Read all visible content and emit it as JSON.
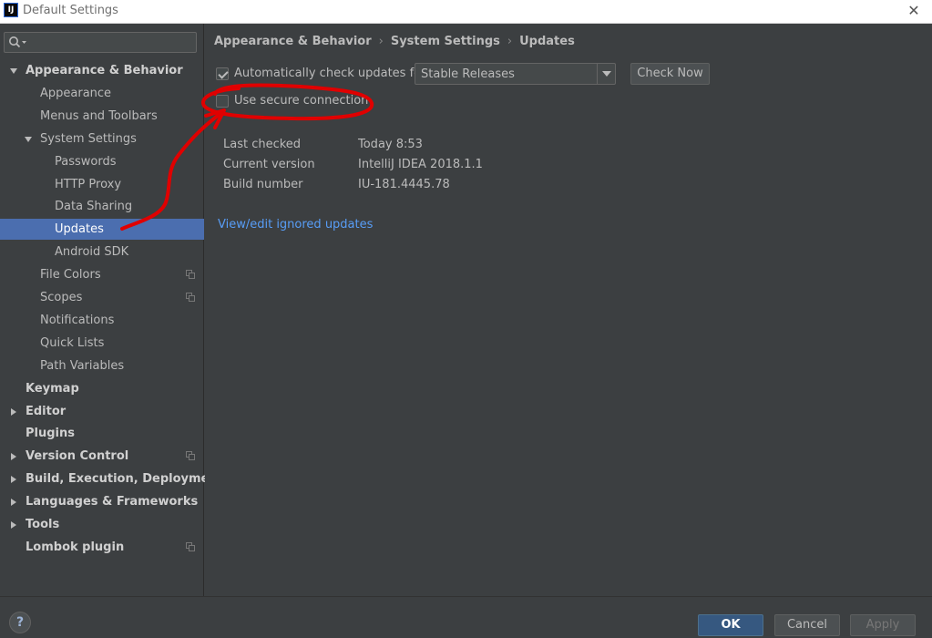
{
  "window": {
    "title": "Default Settings",
    "app_icon_text": "IJ"
  },
  "sidebar": {
    "search": {
      "value": "",
      "placeholder": ""
    },
    "items": [
      {
        "label": "Appearance & Behavior",
        "level": 0,
        "bold": true,
        "expanded": true
      },
      {
        "label": "Appearance",
        "level": 1
      },
      {
        "label": "Menus and Toolbars",
        "level": 1
      },
      {
        "label": "System Settings",
        "level": 1,
        "expanded": true
      },
      {
        "label": "Passwords",
        "level": 2
      },
      {
        "label": "HTTP Proxy",
        "level": 2
      },
      {
        "label": "Data Sharing",
        "level": 2
      },
      {
        "label": "Updates",
        "level": 2,
        "selected": true
      },
      {
        "label": "Android SDK",
        "level": 2
      },
      {
        "label": "File Colors",
        "level": 1,
        "copy_icon": true
      },
      {
        "label": "Scopes",
        "level": 1,
        "copy_icon": true
      },
      {
        "label": "Notifications",
        "level": 1
      },
      {
        "label": "Quick Lists",
        "level": 1
      },
      {
        "label": "Path Variables",
        "level": 1
      },
      {
        "label": "Keymap",
        "level": 0,
        "bold": true
      },
      {
        "label": "Editor",
        "level": 0,
        "bold": true,
        "collapsed": true
      },
      {
        "label": "Plugins",
        "level": 0,
        "bold": true
      },
      {
        "label": "Version Control",
        "level": 0,
        "bold": true,
        "collapsed": true,
        "copy_icon": true
      },
      {
        "label": "Build, Execution, Deployment",
        "level": 0,
        "bold": true,
        "collapsed": true
      },
      {
        "label": "Languages & Frameworks",
        "level": 0,
        "bold": true,
        "collapsed": true
      },
      {
        "label": "Tools",
        "level": 0,
        "bold": true,
        "collapsed": true
      },
      {
        "label": "Lombok plugin",
        "level": 0,
        "bold": true,
        "copy_icon": true
      }
    ]
  },
  "breadcrumb": [
    "Appearance & Behavior",
    "System Settings",
    "Updates"
  ],
  "updates": {
    "auto_check": {
      "label": "Automatically check updates for",
      "checked": true
    },
    "channel": {
      "selected": "Stable Releases"
    },
    "check_now_label": "Check Now",
    "secure_connection": {
      "label": "Use secure connection",
      "checked": false
    },
    "info": [
      {
        "key": "Last checked",
        "value": "Today 8:53"
      },
      {
        "key": "Current version",
        "value": "IntelliJ IDEA 2018.1.1"
      },
      {
        "key": "Build number",
        "value": "IU-181.4445.78"
      }
    ],
    "ignored_link": "View/edit ignored updates"
  },
  "footer": {
    "help": "?",
    "ok": "OK",
    "cancel": "Cancel",
    "apply": "Apply"
  },
  "colors": {
    "selection": "#4b6eaf",
    "link": "#589df6",
    "annotation": "#e00000"
  }
}
